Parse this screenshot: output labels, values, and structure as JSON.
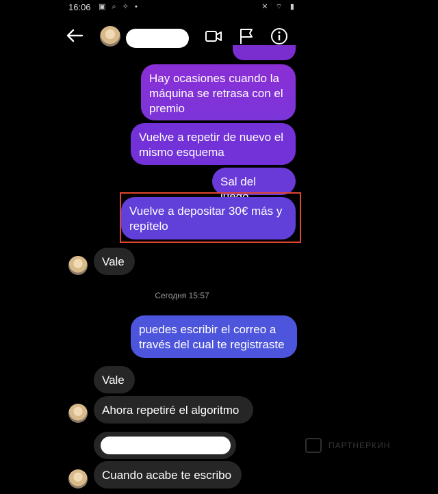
{
  "status_bar": {
    "time": "16:06",
    "left_icons": "▣ ⌕ ✧ •",
    "right_icons": "✕ ⌔ ▮"
  },
  "header": {
    "back_icon": "arrow-left",
    "avatar": "profile-photo",
    "name_redacted": true,
    "icons": [
      "video-call",
      "flag-report",
      "info"
    ]
  },
  "messages": {
    "m1": "Hay ocasiones cuando la máquina se retrasa con el premio",
    "m2": "Vuelve a repetir de nuevo el mismo esquema",
    "m3": "Sal del juego",
    "m4": "Vuelve a depositar 30€ más y repítelo",
    "v1": "Vale",
    "timestamp": "Сегодня 15:57",
    "m5": "puedes escribir el correo a través del cual te registraste",
    "v2": "Vale",
    "m6": "Ahora repetiré el algoritmo",
    "m7": "Cuando acabe te escribo"
  },
  "colors": {
    "highlight": "#e2442e",
    "bubble_incoming": "#262626",
    "bubble_outgoing_top": "#8a2fd6",
    "bubble_outgoing_bottom": "#4d55dc"
  },
  "watermark": {
    "text": "ПАРТНЕРКИН"
  }
}
